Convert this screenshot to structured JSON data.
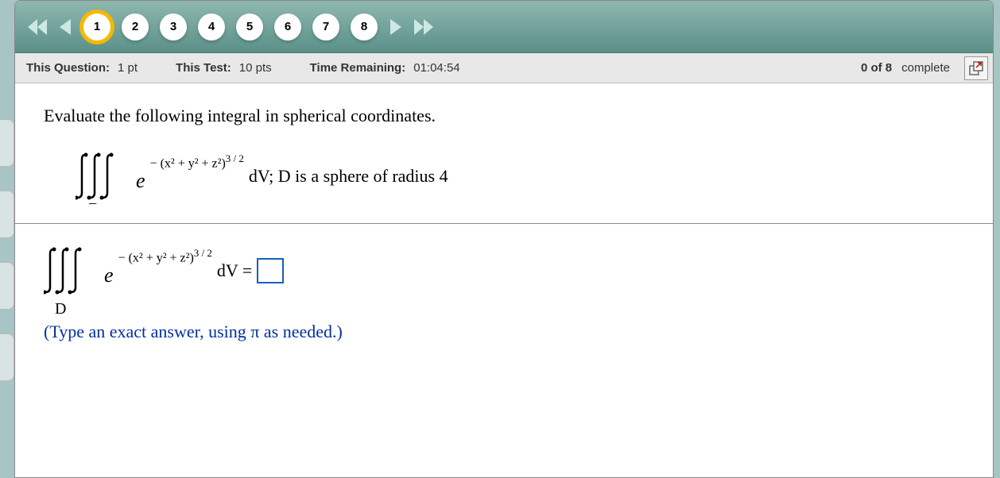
{
  "nav": {
    "questions": [
      "1",
      "2",
      "3",
      "4",
      "5",
      "6",
      "7",
      "8"
    ],
    "active_index": 0
  },
  "info": {
    "question_label": "This Question:",
    "question_pts": "1 pt",
    "test_label": "This Test:",
    "test_pts": "10 pts",
    "time_label": "Time Remaining:",
    "time_value": "01:04:54",
    "progress_count": "0 of 8",
    "progress_word": "complete"
  },
  "question": {
    "prompt": "Evaluate the following integral in spherical coordinates.",
    "exponent_expr": "− (x² + y² + z²)",
    "exponent_pow": "3 / 2",
    "integral_suffix": "dV; D is a sphere of radius 4",
    "domain_letter": "D",
    "base_letter": "e",
    "answer_prefix": "dV =",
    "hint": "(Type an exact answer, using π as needed.)"
  }
}
